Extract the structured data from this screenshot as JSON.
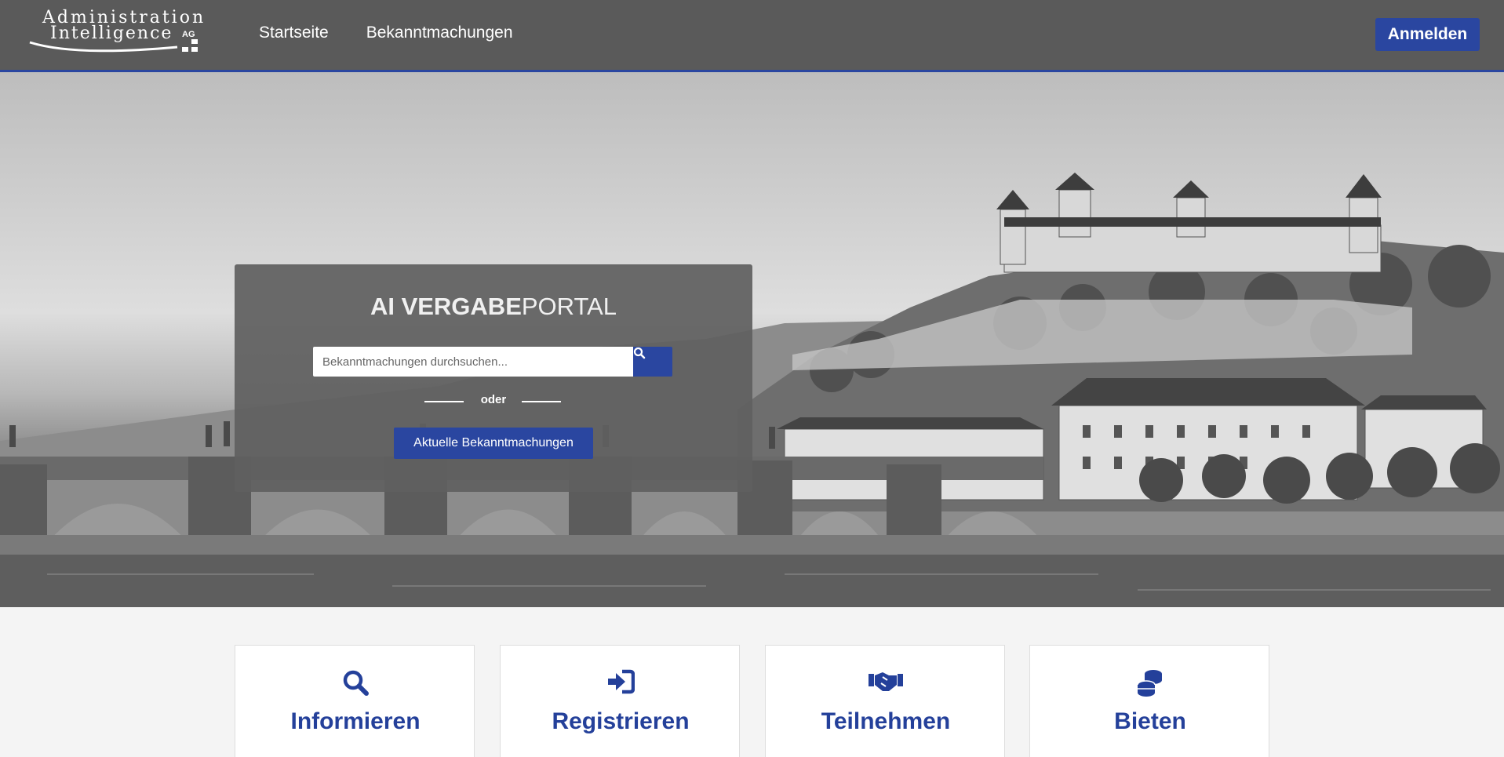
{
  "header": {
    "logo": {
      "line1": "Administration",
      "line2": "Intelligence",
      "suffix": "AG"
    },
    "nav": [
      {
        "label": "Startseite"
      },
      {
        "label": "Bekanntmachungen"
      }
    ],
    "login_label": "Anmelden"
  },
  "hero": {
    "title_bold": "AI VERGABE",
    "title_light": "PORTAL",
    "search": {
      "placeholder": "Bekanntmachungen durchsuchen...",
      "value": ""
    },
    "or_label": "oder",
    "current_button_label": "Aktuelle Bekanntmachungen"
  },
  "cards": [
    {
      "title": "Informieren",
      "icon": "search-icon"
    },
    {
      "title": "Registrieren",
      "icon": "sign-in-icon"
    },
    {
      "title": "Teilnehmen",
      "icon": "handshake-icon"
    },
    {
      "title": "Bieten",
      "icon": "coins-icon"
    }
  ],
  "colors": {
    "accent": "#2a46a0",
    "header_bg": "#5a5a5a",
    "card_title": "#24409a"
  }
}
